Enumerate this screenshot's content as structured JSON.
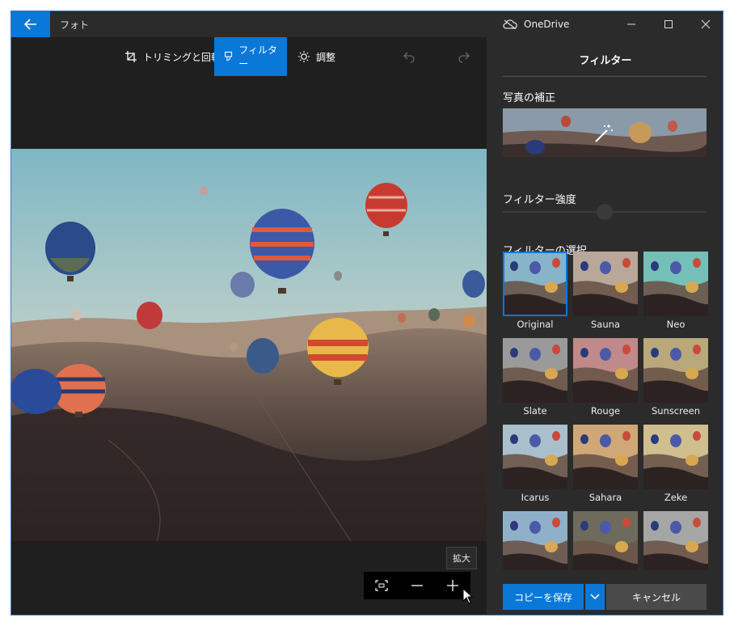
{
  "titlebar": {
    "app_title": "フォト",
    "cloud_label": "OneDrive",
    "icons": [
      "back-arrow-icon",
      "cloud-icon",
      "minimize-icon",
      "maximize-icon",
      "close-icon"
    ]
  },
  "toolbar": {
    "crop_label": "トリミングと回転",
    "filter_label": "フィルター",
    "adjust_label": "調整",
    "icons": [
      "crop-icon",
      "filter-icon",
      "brightness-icon",
      "undo-icon",
      "redo-icon"
    ]
  },
  "zoom": {
    "tooltip": "拡大",
    "icons": [
      "fit-to-window-icon",
      "zoom-out-icon",
      "zoom-in-icon"
    ]
  },
  "panel": {
    "title": "フィルター",
    "enhance_label": "写真の補正",
    "strength_label": "フィルター強度",
    "strength_level": 0.5,
    "select_label": "フィルターの選択",
    "filters": [
      {
        "name": "Original",
        "selected": true,
        "tint": "#87b4c8"
      },
      {
        "name": "Sauna",
        "selected": false,
        "tint": "#b9a79a"
      },
      {
        "name": "Neo",
        "selected": false,
        "tint": "#74c0b8"
      },
      {
        "name": "Slate",
        "selected": false,
        "tint": "#9a9a9a"
      },
      {
        "name": "Rouge",
        "selected": false,
        "tint": "#c08a8a"
      },
      {
        "name": "Sunscreen",
        "selected": false,
        "tint": "#b8a87a"
      },
      {
        "name": "Icarus",
        "selected": false,
        "tint": "#a9c0cc"
      },
      {
        "name": "Sahara",
        "selected": false,
        "tint": "#d0a878"
      },
      {
        "name": "Zeke",
        "selected": false,
        "tint": "#cfbf8f"
      },
      {
        "name": "",
        "selected": false,
        "tint": "#8fb0c8"
      },
      {
        "name": "",
        "selected": false,
        "tint": "#6e6a5c"
      },
      {
        "name": "",
        "selected": false,
        "tint": "#a6a6a6"
      }
    ],
    "save_label": "コピーを保存",
    "cancel_label": "キャンセル"
  },
  "colors": {
    "accent": "#0a78d7",
    "panel_bg": "#2b2b2b",
    "window_bg": "#1f1f1f"
  }
}
